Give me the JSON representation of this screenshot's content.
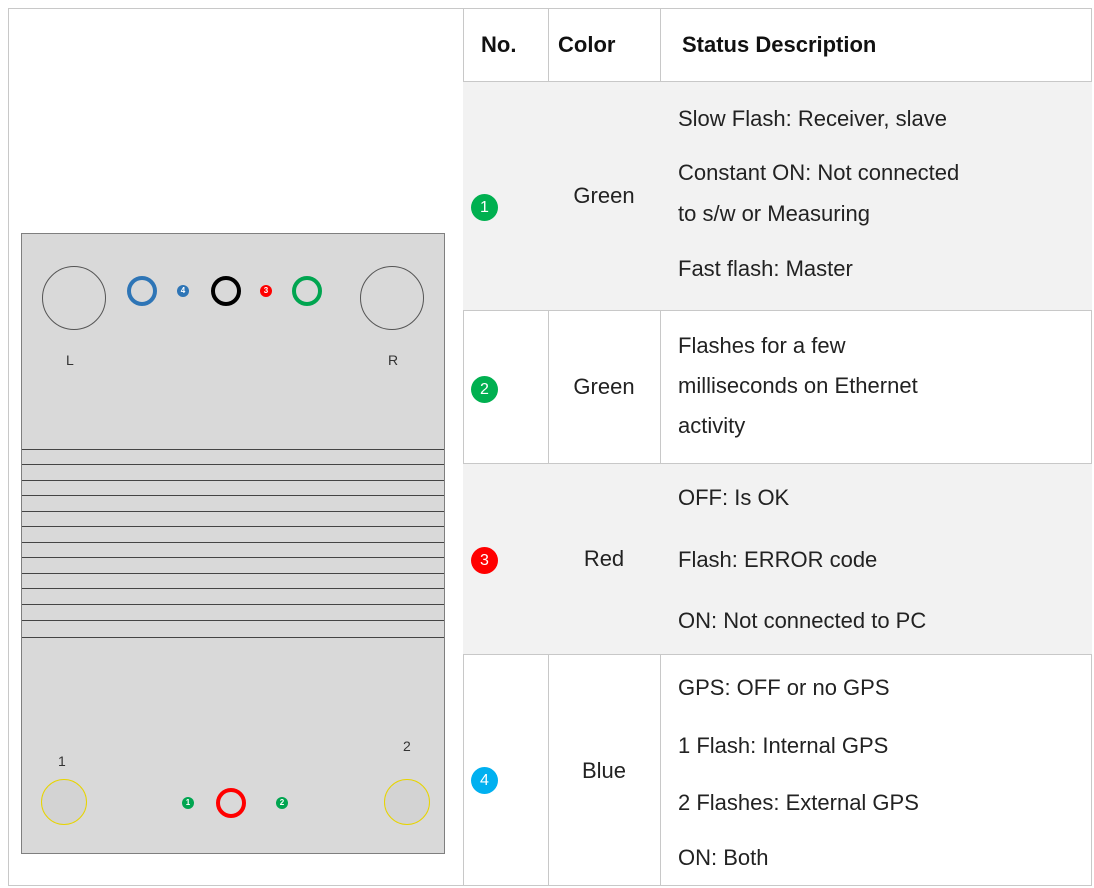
{
  "device": {
    "left_label": "L",
    "right_label": "R",
    "foot1_label": "1",
    "foot2_label": "2",
    "top_dots": [
      "4",
      "3"
    ],
    "bottom_dots": [
      "1",
      "2"
    ],
    "colors": {
      "body": "#d9d9d9",
      "blue_ring": "#2e75b6",
      "black_ring": "#000000",
      "green_ring": "#00a550",
      "red_ring": "#ff0000",
      "foot_outline": "#e7d400"
    }
  },
  "table": {
    "headers": {
      "no": "No.",
      "color": "Color",
      "description": "Status Description"
    },
    "rows": [
      {
        "no": "1",
        "badge_color": "#00b050",
        "color": "Green",
        "lines": [
          "Slow Flash: Receiver, slave",
          "Constant ON: Not connected",
          "to s/w or Measuring",
          "Fast flash: Master"
        ]
      },
      {
        "no": "2",
        "badge_color": "#00b050",
        "color": "Green",
        "lines": [
          "Flashes for a few",
          "milliseconds on Ethernet",
          "activity"
        ]
      },
      {
        "no": "3",
        "badge_color": "#ff0000",
        "color": "Red",
        "lines": [
          "OFF: Is OK",
          "Flash: ERROR code",
          "ON: Not connected to PC"
        ]
      },
      {
        "no": "4",
        "badge_color": "#00b0f0",
        "color": "Blue",
        "lines": [
          "GPS: OFF or no GPS",
          "1 Flash: Internal GPS",
          "2 Flashes: External GPS",
          "ON: Both"
        ]
      }
    ]
  }
}
